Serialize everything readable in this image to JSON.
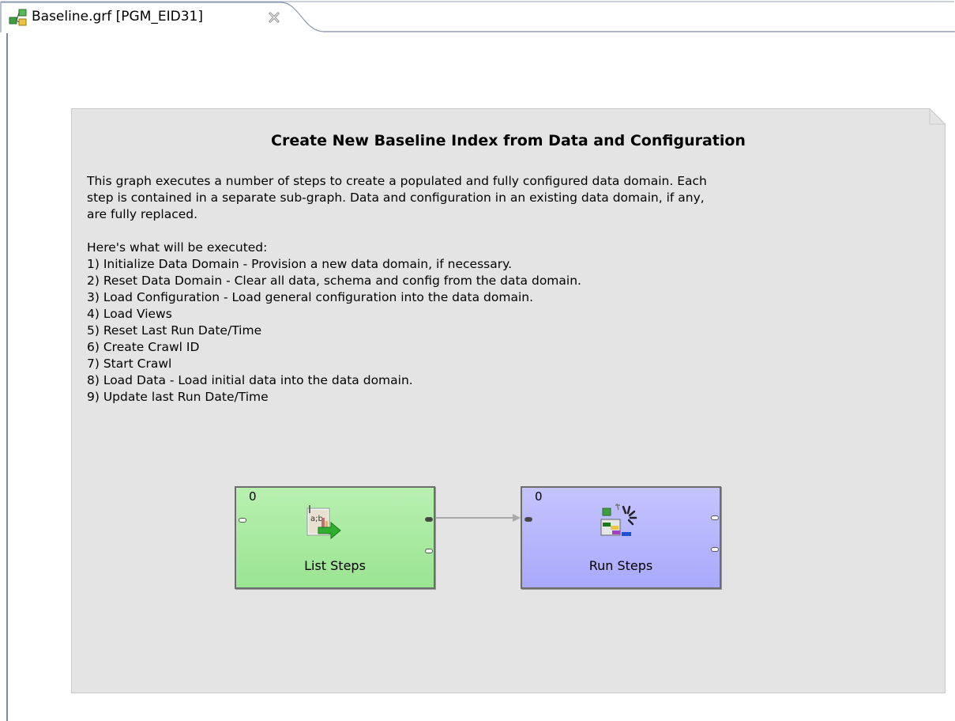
{
  "tab": {
    "title": "Baseline.grf [PGM_EID31]",
    "icon": "graph-file-icon",
    "close_icon": "close-icon"
  },
  "note": {
    "title": "Create New Baseline Index from Data and Configuration",
    "intro_lines": [
      "This graph executes a number of steps to create a populated and fully configured data domain. Each",
      "step is contained in a separate sub-graph. Data and configuration in an existing data domain, if any,",
      "are fully replaced."
    ],
    "steps_heading": "Here's what will be executed:",
    "steps": [
      "1) Initialize Data Domain - Provision a new data domain, if necessary.",
      "2) Reset Data Domain - Clear all data, schema and config from the data domain.",
      "3) Load Configuration - Load general configuration into the data domain.",
      "4) Load Views",
      "5) Reset Last Run Date/Time",
      "6) Create Crawl ID",
      "7) Start Crawl",
      "8) Load Data - Load initial data into the data domain.",
      "9) Update last Run Date/Time"
    ]
  },
  "components": {
    "list_steps": {
      "phase": "0",
      "label": "List Steps",
      "icon": "list-steps-icon",
      "color": "#a6ea9e"
    },
    "run_steps": {
      "phase": "0",
      "label": "Run Steps",
      "icon": "run-graph-icon",
      "color": "#b4b4fd"
    }
  },
  "colors": {
    "note_background": "#e4e4e4",
    "edge": "#a9a9a9"
  }
}
